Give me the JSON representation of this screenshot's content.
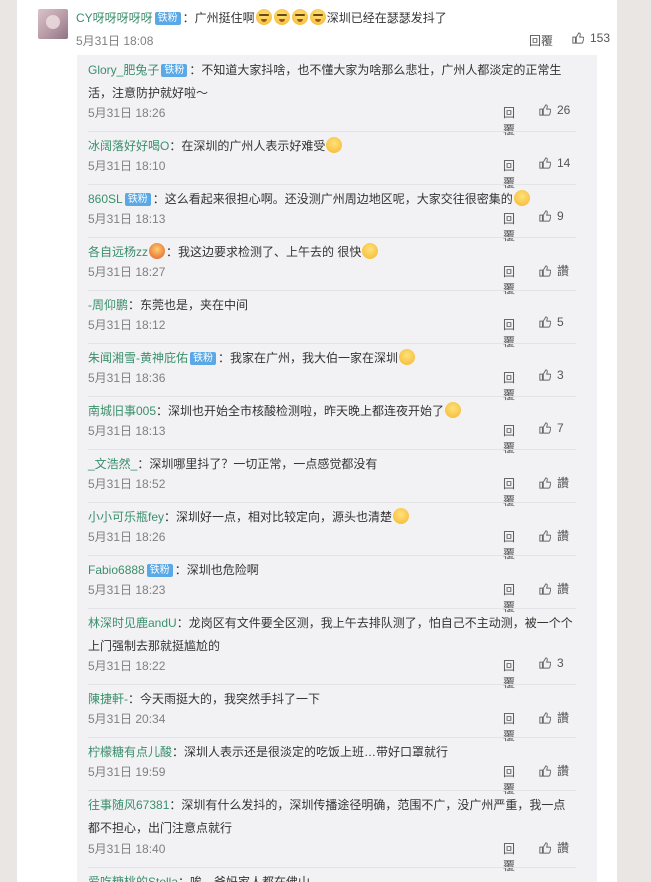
{
  "top_comment": {
    "user": "CY呀呀呀呀呀",
    "badge": "铁粉",
    "text_a": "：广州挺住啊",
    "text_b": "深圳已经在瑟瑟发抖了",
    "time": "5月31日 18:08",
    "reply": "回覆",
    "likes": "153"
  },
  "replies": [
    {
      "user": "Glory_肥兔子",
      "badge": "铁粉",
      "text": "：不知道大家抖啥，也不懂大家为啥那么悲壮，广州人都淡定的正常生活，注意防护就好啦～",
      "time": "5月31日 18:26",
      "reply": "回覆",
      "likes": "26"
    },
    {
      "user": "冰阔落好好喝O",
      "badge": "",
      "text": "：在深圳的广州人表示好难受",
      "time": "5月31日 18:10",
      "reply": "回覆",
      "likes": "14"
    },
    {
      "user": "860SL",
      "badge": "铁粉",
      "text": "：这么看起来很担心啊。还没测广州周边地区呢，大家交往很密集的",
      "time": "5月31日 18:13",
      "reply": "回覆",
      "likes": "9"
    },
    {
      "user": "各自远杨zz",
      "badge": "",
      "text": "：我这边要求检测了、上午去的 很快",
      "time": "5月31日 18:27",
      "reply": "回覆",
      "likes": "讚"
    },
    {
      "user": "-周仰鹏",
      "badge": "",
      "text": "：东莞也是，夹在中间",
      "time": "5月31日 18:12",
      "reply": "回覆",
      "likes": "5"
    },
    {
      "user": "朱闻湘雪-黄神庇佑",
      "badge": "铁粉",
      "text": "：我家在广州，我大伯一家在深圳",
      "time": "5月31日 18:36",
      "reply": "回覆",
      "likes": "3"
    },
    {
      "user": "南城旧事005",
      "badge": "",
      "text": "：深圳也开始全市核酸检测啦，昨天晚上都连夜开始了",
      "time": "5月31日 18:13",
      "reply": "回覆",
      "likes": "7"
    },
    {
      "user": "_文浩然_",
      "badge": "",
      "text": "：深圳哪里抖了？一切正常，一点感觉都没有",
      "time": "5月31日 18:52",
      "reply": "回覆",
      "likes": "讚"
    },
    {
      "user": "小小可乐瓶fey",
      "badge": "",
      "text": "：深圳好一点，相对比较定向，源头也清楚",
      "time": "5月31日 18:26",
      "reply": "回覆",
      "likes": "讚"
    },
    {
      "user": "Fabio6888",
      "badge": "铁粉",
      "text": "：深圳也危险啊",
      "time": "5月31日 18:23",
      "reply": "回覆",
      "likes": "讚"
    },
    {
      "user": "林深时见鹿andU",
      "badge": "",
      "text": "：龙岗区有文件要全区测，我上午去排队测了，怕自己不主动测，被一个个上门强制去那就挺尴尬的",
      "time": "5月31日 18:22",
      "reply": "回覆",
      "likes": "3"
    },
    {
      "user": "陳捷軒-",
      "badge": "",
      "text": "：今天雨挺大的，我突然手抖了一下",
      "time": "5月31日 20:34",
      "reply": "回覆",
      "likes": "讚"
    },
    {
      "user": "柠檬糖有点儿酸",
      "badge": "",
      "text": "：深圳人表示还是很淡定的吃饭上班…带好口罩就行",
      "time": "5月31日 19:59",
      "reply": "回覆",
      "likes": "讚"
    },
    {
      "user": "往事随风67381",
      "badge": "",
      "text": "：深圳有什么发抖的，深圳传播途径明确，范围不广，没广州严重，我一点都不担心，出门注意点就行",
      "time": "5月31日 18:40",
      "reply": "回覆",
      "likes": "讚"
    },
    {
      "user": "爱吃糖桃的Stella",
      "badge": "",
      "text": "：唉，爸妈家人都在佛山",
      "time": "",
      "reply": "",
      "likes": ""
    }
  ],
  "colors": {
    "username": "#3b8f6b",
    "badge": "#5aa9e6",
    "meta": "#808080",
    "sub_bg": "#f2f2f5"
  }
}
